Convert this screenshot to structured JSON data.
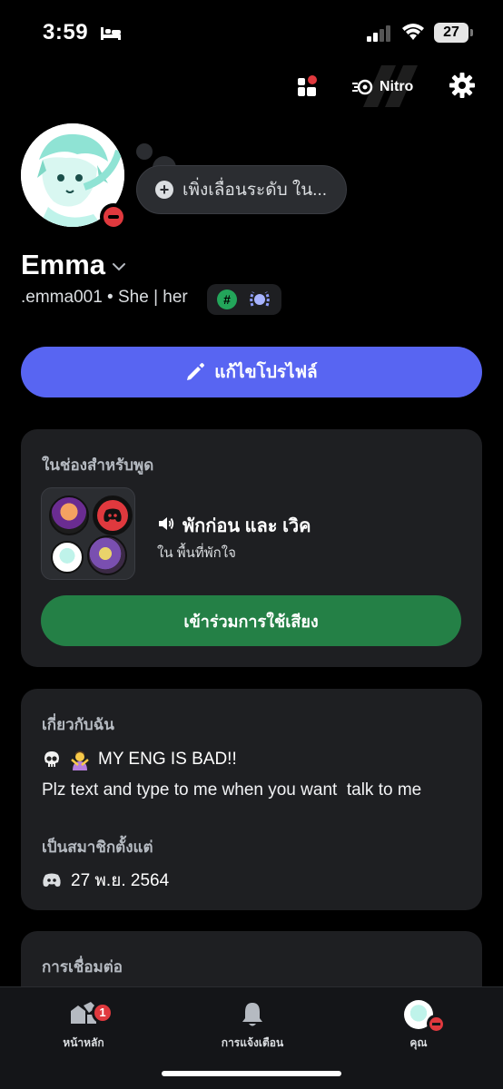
{
  "status_bar": {
    "time": "3:59",
    "battery": "27"
  },
  "top_actions": {
    "nitro_label": "Nitro"
  },
  "profile": {
    "status_prompt": "เพิ่งเลื่อนระดับ ใน...",
    "display_name": "Emma",
    "username_line": ".emma001 • She | her",
    "badge_hash": "#"
  },
  "edit_profile_label": "แก้ไขโปรไฟล์",
  "voice_card": {
    "title": "ในช่องสำหรับพูด",
    "channel": "พักก่อน และ เวิค",
    "server": "ใน พื้นที่พักใจ",
    "join_label": "เข้าร่วมการใช้เสียง"
  },
  "about_card": {
    "title": "เกี่ยวกับฉัน",
    "line1": "MY ENG IS BAD!!",
    "line2": "Plz text and type to me when you want  talk to me",
    "member_since_title": "เป็นสมาชิกตั้งแต่",
    "member_since_date": "27 พ.ย. 2564"
  },
  "connections_card": {
    "title": "การเชื่อมต่อ"
  },
  "bottom_nav": {
    "home_label": "หน้าหลัก",
    "home_badge": "1",
    "notifications_label": "การแจ้งเตือน",
    "you_label": "คุณ"
  },
  "colors": {
    "blurple": "#5865f2",
    "green": "#248046",
    "dnd_red": "#e0393e",
    "card_bg": "#1e1f22"
  }
}
